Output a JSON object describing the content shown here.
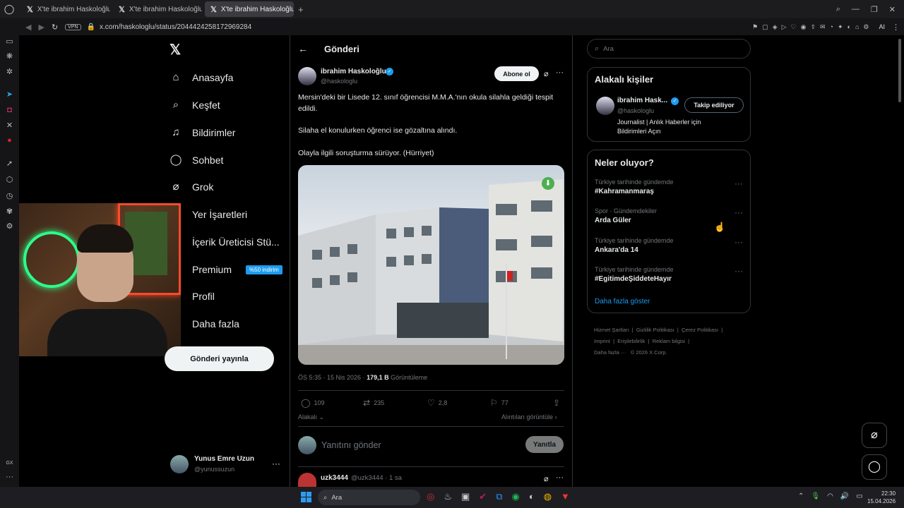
{
  "browser": {
    "tabs": [
      {
        "label": "X'te ibrahim Haskoloğlu: \""
      },
      {
        "label": "X'te ibrahim Haskoloğlu: \""
      },
      {
        "label": "X'te ibrahim Haskoloğlu: \""
      }
    ],
    "vpn": "VPN",
    "url": "x.com/haskologlu/status/2044424258172969284",
    "ai": "AI"
  },
  "nav": {
    "items": [
      {
        "label": "Anasayfa",
        "icon": "home-icon"
      },
      {
        "label": "Keşfet",
        "icon": "search-icon"
      },
      {
        "label": "Bildirimler",
        "icon": "bell-icon"
      },
      {
        "label": "Sohbet",
        "icon": "chat-icon"
      },
      {
        "label": "Grok",
        "icon": "grok-icon"
      },
      {
        "label": "Yer İşaretleri",
        "icon": "bookmark-icon"
      },
      {
        "label": "İçerik Üreticisi Stü...",
        "icon": "creator-icon"
      },
      {
        "label": "Premium",
        "icon": "premium-icon"
      },
      {
        "label": "Profil",
        "icon": "profile-icon"
      },
      {
        "label": "Daha fazla",
        "icon": "more-icon"
      }
    ],
    "premium_badge": "%50 indirim",
    "post_button": "Gönderi yayınla",
    "account_name": "Yunus Emre Uzun",
    "account_handle": "@yunussuzun"
  },
  "main": {
    "header": "Gönderi",
    "author_name": "ibrahim Haskoloğlu",
    "author_handle": "@haskologlu",
    "subscribe": "Abone ol",
    "text1": "Mersin'deki bir Lisede 12. sınıf öğrencisi M.M.A.'nın okula silahla geldiği tespit edildi.",
    "text2": "Silaha el konulurken öğrenci ise gözaltına alındı.",
    "text3": "Olayla ilgili soruşturma sürüyor. (Hürriyet)",
    "timestamp": "ÖS 5:35 · 15 Nis 2026 · ",
    "views": "179,1 B",
    "views_label": "Görüntüleme",
    "replies": "109",
    "reposts": "235",
    "likes": "2,8",
    "bookmarks": "77",
    "relevance": "Alakalı",
    "quotes": "Alıntıları görüntüle",
    "reply_placeholder": "Yanıtını gönder",
    "reply_button": "Yanıtla",
    "reply_user": "uzk3444",
    "reply_handle": "@uzk3444 · 1 sa"
  },
  "right": {
    "search_placeholder": "Ara",
    "related_title": "Alakalı kişiler",
    "related_name": "ibrahim Hask...",
    "related_handle": "@haskologlu",
    "related_bio": "Journalist | Anlık Haberler için Bildirimleri Açın",
    "following": "Takip ediliyor",
    "trends_title": "Neler oluyor?",
    "trends": [
      {
        "label": "Türkiye tarihinde gündemde",
        "title": "#Kahramanmaraş"
      },
      {
        "label": "Spor · Gündemdekiler",
        "title": "Arda Güler"
      },
      {
        "label": "Türkiye tarihinde gündemde",
        "title": "Ankara'da 14"
      },
      {
        "label": "Türkiye tarihinde gündemde",
        "title": "#EgitimdeŞiddeteHayır"
      }
    ],
    "show_more": "Daha fazla göster",
    "footer": [
      "Hizmet Şartları",
      "Gizlilik Politikası",
      "Çerez Politikası",
      "Imprint",
      "Erişilebilirlik",
      "Reklam bilgisi",
      "Daha fazla ···",
      "© 2026 X Corp."
    ]
  },
  "taskbar": {
    "search": "Ara",
    "time": "22:30",
    "date": "15.04.2026",
    "gx": "GX"
  }
}
